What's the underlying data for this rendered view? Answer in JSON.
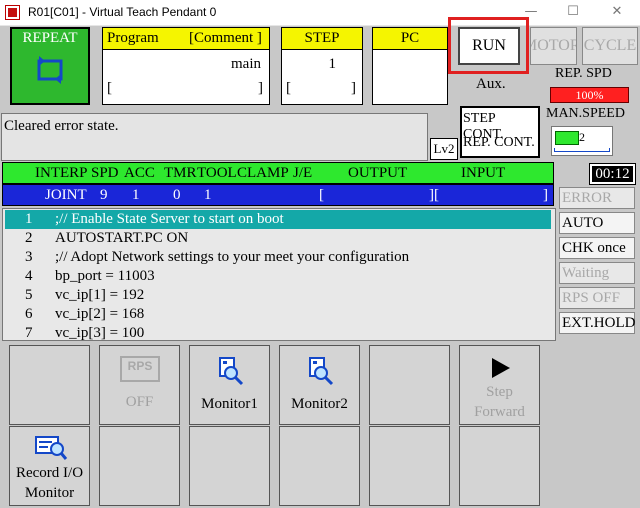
{
  "window": {
    "title": "R01[C01] - Virtual Teach Pendant 0",
    "minimize": "—",
    "maximize": "☐",
    "close": "✕"
  },
  "status": {
    "repeat_label": "REPEAT",
    "program_label": "Program",
    "comment_label": "[Comment ]",
    "program_name": "main",
    "program_bracket_left": "[",
    "program_bracket_right": "]",
    "step_label": "STEP",
    "step_value": "1",
    "step_bracket_left": "[",
    "step_bracket_right": "]",
    "pc_label": "PC"
  },
  "controls": {
    "run_label": "RUN",
    "motor_label": "MOTOR",
    "cycle_label": "CYCLE",
    "aux_label": "Aux.",
    "rep_spd_label": "REP. SPD",
    "rep_spd_value": "100%",
    "step_cont_label": "STEP CONT.",
    "rep_cont_label": "REP. CONT.",
    "man_speed_label": "MAN.SPEED",
    "man_speed_value": "2",
    "lv_label": "Lv2"
  },
  "message": "Cleared error state.",
  "interp": {
    "headers": [
      "INTERP",
      "SPD",
      "ACC",
      "TMR",
      "TOOL",
      "CLAMP",
      "J/E",
      "OUTPUT",
      "INPUT"
    ],
    "values": [
      "JOINT",
      "9",
      "1",
      "0",
      "1",
      "[",
      "][",
      "]"
    ],
    "timer": "00:12"
  },
  "listing": [
    {
      "num": "1",
      "text": ";// Enable State Server to start on boot"
    },
    {
      "num": "2",
      "text": "AUTOSTART.PC ON"
    },
    {
      "num": "3",
      "text": ";// Adopt Network settings to your meet your configuration"
    },
    {
      "num": "4",
      "text": "bp_port = 11003"
    },
    {
      "num": "5",
      "text": "vc_ip[1] = 192"
    },
    {
      "num": "6",
      "text": "vc_ip[2] = 168"
    },
    {
      "num": "7",
      "text": "vc_ip[3] = 100"
    }
  ],
  "modes": {
    "error": "ERROR",
    "auto": "AUTO",
    "chk_once": "CHK once",
    "waiting": "Waiting",
    "rps_off": "RPS OFF",
    "ext_hold": "EXT.HOLD"
  },
  "functions": {
    "rps_badge": "RPS",
    "rps_off": "OFF",
    "monitor1": "Monitor1",
    "monitor2": "Monitor2",
    "step_forward_1": "Step",
    "step_forward_2": "Forward",
    "record_io_1": "Record I/O",
    "record_io_2": "Monitor"
  },
  "colors": {
    "repeat_green": "#2eb82e",
    "interp_green": "#2ee82e",
    "joint_blue": "#1a26d8",
    "selected_line": "#14a8a8",
    "rep_spd_red": "#ff2020",
    "highlight_red": "#e02020"
  }
}
